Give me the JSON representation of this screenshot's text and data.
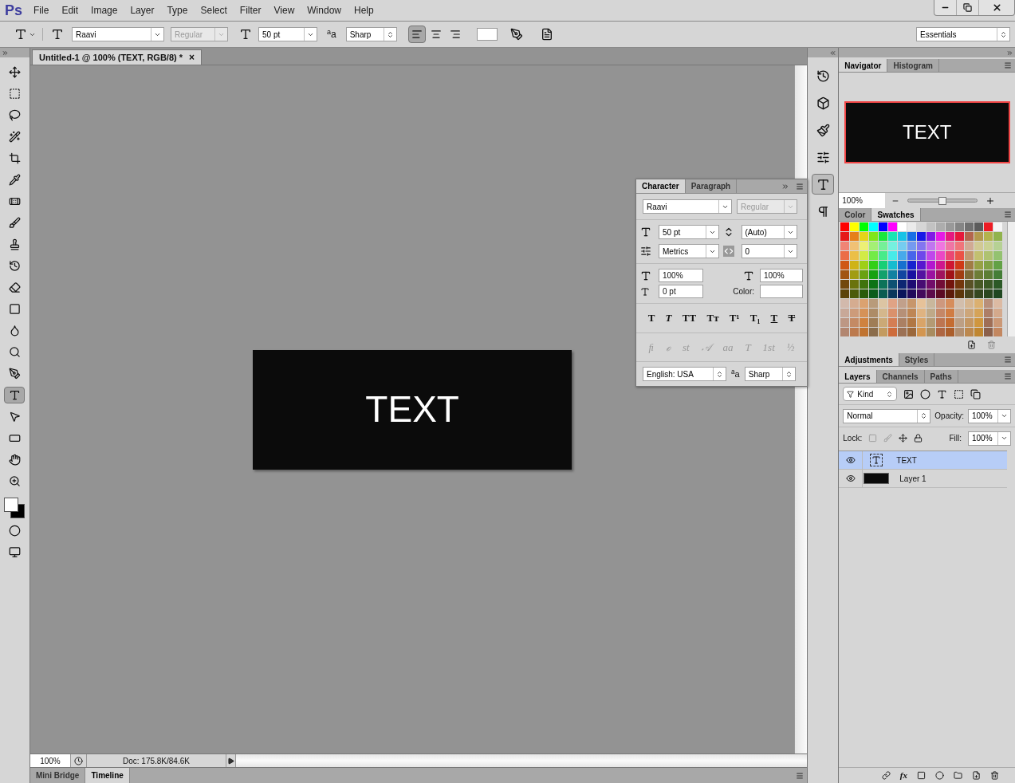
{
  "app_logo": "Ps",
  "menu": [
    "File",
    "Edit",
    "Image",
    "Layer",
    "Type",
    "Select",
    "Filter",
    "View",
    "Window",
    "Help"
  ],
  "options_bar": {
    "font_family": "Raavi",
    "font_style": "Regular",
    "font_style_disabled": true,
    "font_size": "50 pt",
    "antialias_icon": "$^{a}$a",
    "antialias": "Sharp",
    "align": [
      {
        "selected": true
      },
      {
        "selected": false
      },
      {
        "selected": false
      }
    ],
    "workspace": "Essentials"
  },
  "tools": [
    {
      "selected": false
    },
    {
      "selected": false
    },
    {
      "selected": false
    },
    {
      "selected": false
    },
    {
      "selected": false
    },
    {
      "selected": false
    },
    {
      "selected": false
    },
    {
      "selected": false
    },
    {
      "selected": false
    },
    {
      "selected": false
    },
    {
      "selected": false
    },
    {
      "selected": false
    },
    {
      "selected": false
    },
    {
      "selected": false
    },
    {
      "selected": false
    },
    {
      "selected": true
    },
    {
      "selected": false
    },
    {
      "selected": false
    },
    {
      "selected": false
    },
    {
      "selected": false
    }
  ],
  "document_tab": {
    "title": "Untitled-1 @ 100% (TEXT, RGB/8) *",
    "close": "×"
  },
  "canvas": {
    "text": "TEXT"
  },
  "status_bar": {
    "zoom": "100%",
    "doc": "Doc: 175.8K/84.6K"
  },
  "bottom_tabs": [
    {
      "label": "Mini Bridge",
      "selected": false
    },
    {
      "label": "Timeline",
      "selected": true
    }
  ],
  "character_panel": {
    "tabs": [
      {
        "label": "Character",
        "selected": true
      },
      {
        "label": "Paragraph",
        "selected": false
      }
    ],
    "font_family": "Raavi",
    "font_style": "Regular",
    "font_size": "50 pt",
    "leading": "(Auto)",
    "kerning": "Metrics",
    "tracking": "0",
    "vertical_scale": "100%",
    "horizontal_scale": "100%",
    "baseline_shift": "0 pt",
    "color_label": "Color:",
    "style_buttons": [
      "T",
      "T",
      "TT",
      "Tт",
      "T¹",
      "T₁",
      "T",
      "T"
    ],
    "opentype_buttons": [
      "ﬁ",
      "ℴ",
      "st",
      "𝒜",
      "aa",
      "T",
      "1st",
      "½"
    ],
    "language": "English: USA",
    "antialias_icon": "$^{a}$a",
    "antialias": "Sharp"
  },
  "dock_tools": [
    {
      "selected": false
    },
    {
      "selected": false
    },
    {
      "selected": false
    },
    {
      "selected": false
    },
    {
      "selected": true
    },
    {
      "selected": false
    }
  ],
  "navigator": {
    "tabs": [
      {
        "label": "Navigator",
        "selected": true
      },
      {
        "label": "Histogram",
        "selected": false
      }
    ],
    "preview_text": "TEXT",
    "zoom": "100%",
    "zoom_slider": {
      "level": 0.5
    }
  },
  "swatches_panel": {
    "tabs": [
      {
        "label": "Color",
        "selected": false
      },
      {
        "label": "Swatches",
        "selected": true
      }
    ]
  },
  "adjustments_tabs": [
    {
      "label": "Adjustments",
      "selected": true
    },
    {
      "label": "Styles",
      "selected": false
    }
  ],
  "layers_panel": {
    "tabs": [
      {
        "label": "Layers",
        "selected": true
      },
      {
        "label": "Channels",
        "selected": false
      },
      {
        "label": "Paths",
        "selected": false
      }
    ],
    "filter": "Kind",
    "blend_mode": "Normal",
    "opacity_label": "Opacity:",
    "opacity": "100%",
    "lock_label": "Lock:",
    "fill_label": "Fill:",
    "fill": "100%",
    "layers": [
      {
        "name": "TEXT",
        "kind": "text",
        "selected": true,
        "visible": true
      },
      {
        "name": "Layer 1",
        "kind": "fill",
        "selected": false,
        "visible": true
      }
    ],
    "fx_label": "fx"
  }
}
